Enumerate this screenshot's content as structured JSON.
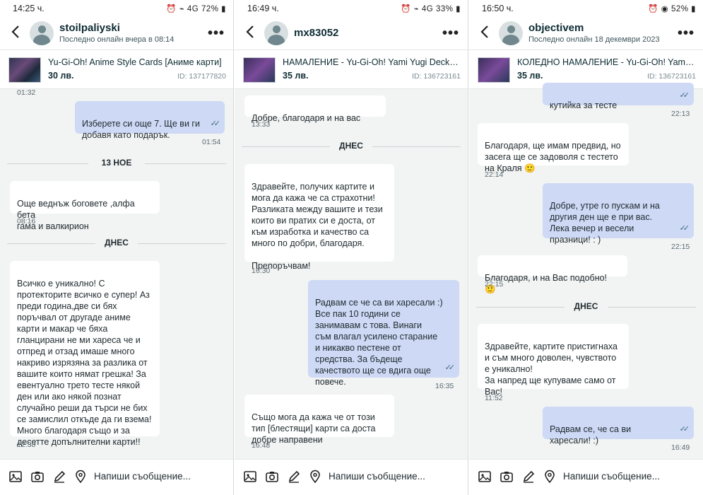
{
  "panels": [
    {
      "status": {
        "time": "14:25 ч.",
        "right": "⏰ ⌁ 4G 72% ▮"
      },
      "header": {
        "username": "stoilpaliyski",
        "last_seen": "Последно онлайн вчера в 08:14"
      },
      "product": {
        "title": "Yu-Gi-Oh! Anime Style Cards [Аниме карти]",
        "price": "30 лв.",
        "id": "ID: 137177820"
      },
      "input_placeholder": "Напиши съобщение...",
      "messages": [
        {
          "time_top": "01:32"
        },
        {
          "text": "Изберете си още 7. Ще ви ги\nдобавя като подарък.",
          "time": "01:54"
        },
        {
          "sep": "13 НОЕ"
        },
        {
          "text": "Още веднъж боговете ,алфа бета\nгама и валкирион",
          "time": "08:16"
        },
        {
          "sep": "ДНЕС"
        },
        {
          "text": "Всичко е уникално! С\nпротекторите всичко е супер! Аз\nпреди година,две си бях\nпоръчвал от другаде аниме\nкарти и макар че бяха\nгланцирани не ми хареса че и\nотпред и отзад имаше много\nнакриво изрязяна за разлика от\nвашите които нямат грешка! За\nевентуално трето тесте някой\nден или ако някой познат\nслучайно реши да търси не бих\nсе замислил откъде да ги взема!\nМного благодаря също и за\nдесетте допълнителни карти!!",
          "time": "12:38"
        }
      ]
    },
    {
      "status": {
        "time": "16:49 ч.",
        "right": "⏰ ⌁ 4G 33% ▮"
      },
      "header": {
        "username": "mx83052",
        "last_seen": ""
      },
      "product": {
        "title": "НАМАЛЕНИЕ - Yu-Gi-Oh! Yami Yugi Deck - Ani...",
        "price": "35 лв.",
        "id": "ID: 136723161"
      },
      "input_placeholder": "Напиши съобщение...",
      "messages": [
        {
          "text": "Добре, благодаря и на вас",
          "time": "13:33"
        },
        {
          "sep": "ДНЕС"
        },
        {
          "text": "Здравейте, получих картите и\nмога да кажа че са страхотни!\nРазликата между вашите и тези\nкоито ви пратих си е доста, от\nкъм изработка и качество са\nмного по добри,  благодаря.\n\nПрепоръчвам!",
          "time": "16:30"
        },
        {
          "text": "Радвам се че са ви харесали :)\nВсе пак 10 години се\nзанимавам с това. Винаги\nсъм влагал усилено старание\nи никакво пестене от\nсредства. За бъдеще\nкачеството ще се вдига още\nповече.",
          "time": "16:35"
        },
        {
          "text": "Също мога да кажа че от този\nтип [блестящи] карти са доста\nдобре направени",
          "time": "16:48"
        }
      ]
    },
    {
      "status": {
        "time": "16:50 ч.",
        "right": "⏰ ◉ 52% ▮"
      },
      "header": {
        "username": "objectivem",
        "last_seen": "Последно онлайн 18 декември 2023"
      },
      "product": {
        "title": "КОЛЕДНО НАМАЛЕНИЕ - Yu-Gi-Oh! Yami Yug...",
        "price": "35 лв.",
        "id": "ID: 136723161"
      },
      "input_placeholder": "Напиши съобщение...",
      "messages": [
        {
          "text": "кутийка за тесте",
          "time": "22:13"
        },
        {
          "text": "Благодаря, ще имам предвид, но\nзасега ще се задоволя с тестето\nна Краля 🙂",
          "time": "22:14"
        },
        {
          "text": "Добре, утре го пускам и на\nдругия ден ще е при вас.\nЛека вечер и весели\nпразници! : )",
          "time": "22:15"
        },
        {
          "text": "Благодаря, и на Вас подобно! 🙂",
          "time": "22:15"
        },
        {
          "sep": "ДНЕС"
        },
        {
          "text": "Здравейте, картите пристигнаха\nи съм много доволен, чувството\nе уникално!\nЗа напред ще купуваме само от\nВас!",
          "time": "11:52"
        },
        {
          "text": "Радвам се, че са ви\nхаресали! :)",
          "time": "16:49"
        }
      ]
    }
  ]
}
